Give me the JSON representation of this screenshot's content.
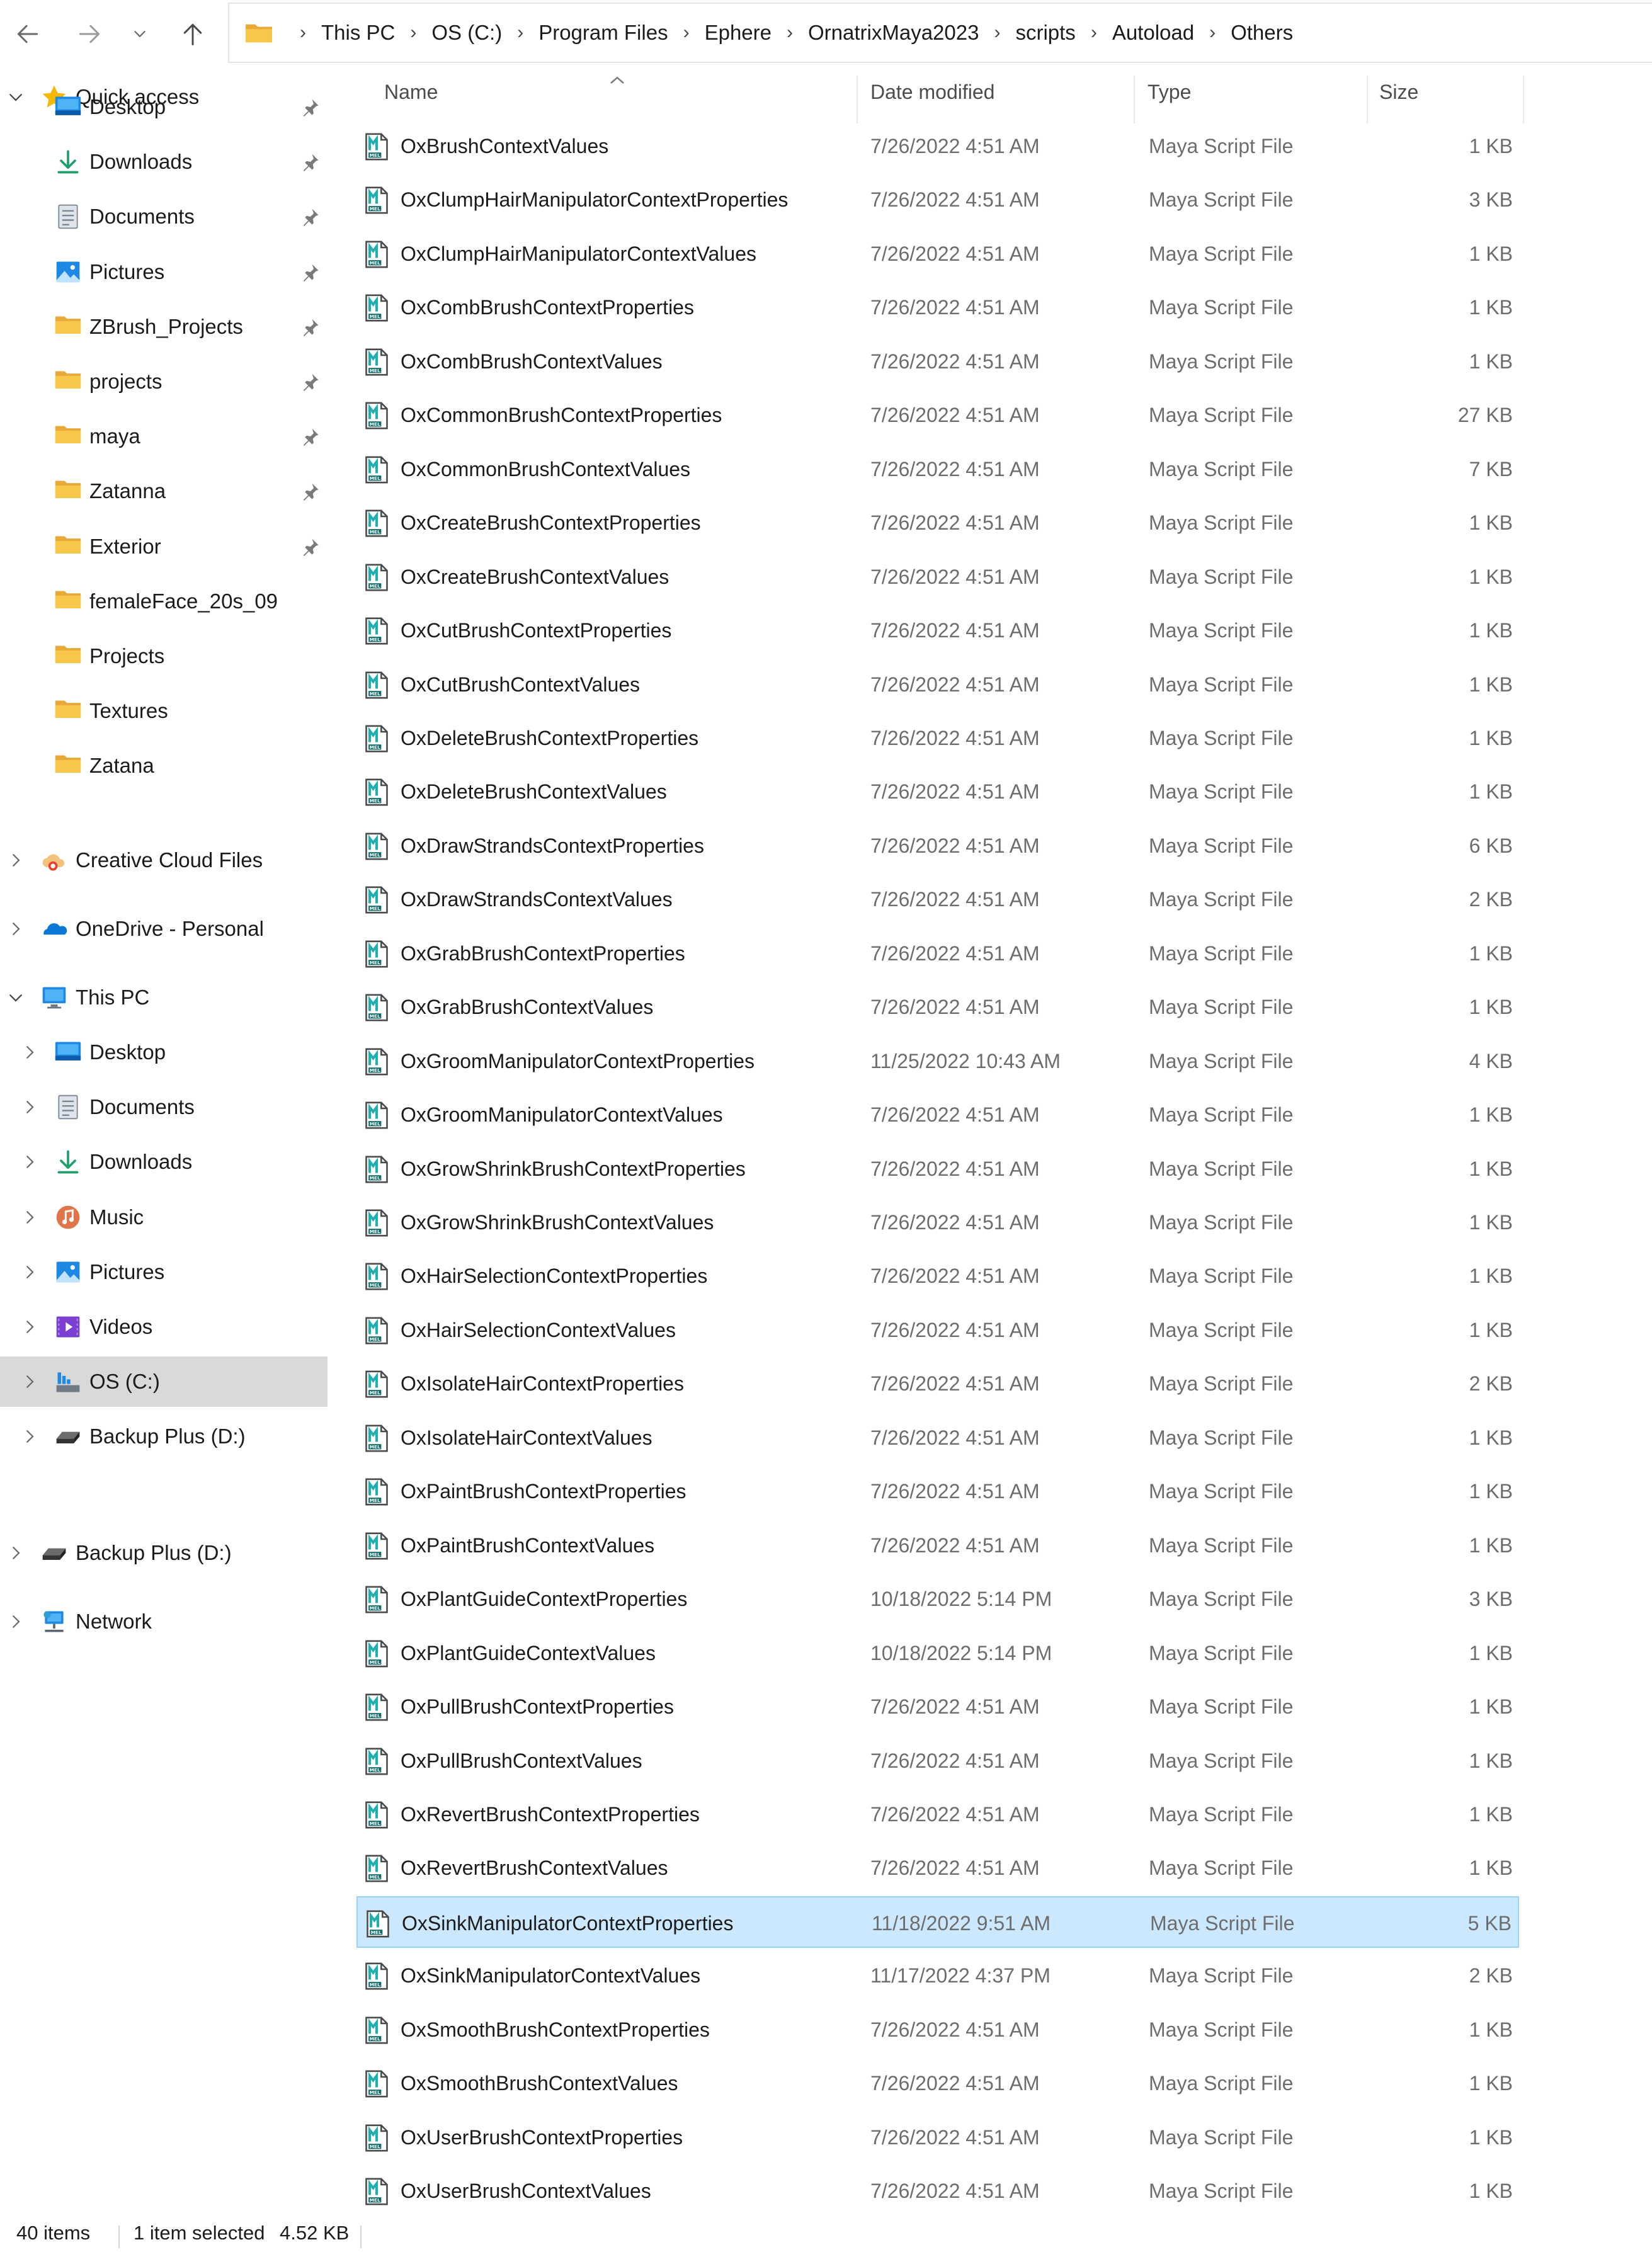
{
  "address": {
    "crumbs": [
      "This PC",
      "OS (C:)",
      "Program Files",
      "Ephere",
      "OrnatrixMaya2023",
      "scripts",
      "Autoload",
      "Others"
    ],
    "icon": "folder-icon"
  },
  "sidebar": {
    "quick_access": {
      "label": "Quick access",
      "icon": "star-icon",
      "items": [
        {
          "label": "Desktop",
          "icon": "desktop-icon",
          "pinned": true
        },
        {
          "label": "Downloads",
          "icon": "download-icon",
          "pinned": true
        },
        {
          "label": "Documents",
          "icon": "documents-icon",
          "pinned": true
        },
        {
          "label": "Pictures",
          "icon": "pictures-icon",
          "pinned": true
        },
        {
          "label": "ZBrush_Projects",
          "icon": "folder-icon",
          "pinned": true
        },
        {
          "label": "projects",
          "icon": "folder-icon",
          "pinned": true
        },
        {
          "label": "maya",
          "icon": "folder-icon",
          "pinned": true
        },
        {
          "label": "Zatanna",
          "icon": "folder-icon",
          "pinned": true
        },
        {
          "label": "Exterior",
          "icon": "folder-icon",
          "pinned": true
        },
        {
          "label": "femaleFace_20s_09",
          "icon": "folder-icon",
          "pinned": false
        },
        {
          "label": "Projects",
          "icon": "folder-icon",
          "pinned": false
        },
        {
          "label": "Textures",
          "icon": "folder-icon",
          "pinned": false
        },
        {
          "label": "Zatana",
          "icon": "folder-icon",
          "pinned": false
        }
      ]
    },
    "creative_cloud": {
      "label": "Creative Cloud Files",
      "icon": "creative-cloud-icon"
    },
    "onedrive": {
      "label": "OneDrive - Personal",
      "icon": "onedrive-cloud-icon"
    },
    "this_pc": {
      "label": "This PC",
      "icon": "computer-icon",
      "items": [
        {
          "label": "Desktop",
          "icon": "desktop-icon"
        },
        {
          "label": "Documents",
          "icon": "documents-icon"
        },
        {
          "label": "Downloads",
          "icon": "download-icon"
        },
        {
          "label": "Music",
          "icon": "music-icon"
        },
        {
          "label": "Pictures",
          "icon": "pictures-icon"
        },
        {
          "label": "Videos",
          "icon": "videos-icon"
        },
        {
          "label": "OS (C:)",
          "icon": "drive-icon",
          "selected": true
        },
        {
          "label": "Backup Plus (D:)",
          "icon": "external-drive-icon"
        }
      ]
    },
    "backup_plus": {
      "label": "Backup Plus (D:)",
      "icon": "external-drive-icon"
    },
    "network": {
      "label": "Network",
      "icon": "network-icon"
    }
  },
  "columns": {
    "name": "Name",
    "date": "Date modified",
    "type": "Type",
    "size": "Size"
  },
  "files": [
    {
      "name": "OxBrushContextValues",
      "date": "7/26/2022 4:51 AM",
      "type": "Maya Script File",
      "size": "1 KB"
    },
    {
      "name": "OxClumpHairManipulatorContextProperties",
      "date": "7/26/2022 4:51 AM",
      "type": "Maya Script File",
      "size": "3 KB"
    },
    {
      "name": "OxClumpHairManipulatorContextValues",
      "date": "7/26/2022 4:51 AM",
      "type": "Maya Script File",
      "size": "1 KB"
    },
    {
      "name": "OxCombBrushContextProperties",
      "date": "7/26/2022 4:51 AM",
      "type": "Maya Script File",
      "size": "1 KB"
    },
    {
      "name": "OxCombBrushContextValues",
      "date": "7/26/2022 4:51 AM",
      "type": "Maya Script File",
      "size": "1 KB"
    },
    {
      "name": "OxCommonBrushContextProperties",
      "date": "7/26/2022 4:51 AM",
      "type": "Maya Script File",
      "size": "27 KB"
    },
    {
      "name": "OxCommonBrushContextValues",
      "date": "7/26/2022 4:51 AM",
      "type": "Maya Script File",
      "size": "7 KB"
    },
    {
      "name": "OxCreateBrushContextProperties",
      "date": "7/26/2022 4:51 AM",
      "type": "Maya Script File",
      "size": "1 KB"
    },
    {
      "name": "OxCreateBrushContextValues",
      "date": "7/26/2022 4:51 AM",
      "type": "Maya Script File",
      "size": "1 KB"
    },
    {
      "name": "OxCutBrushContextProperties",
      "date": "7/26/2022 4:51 AM",
      "type": "Maya Script File",
      "size": "1 KB"
    },
    {
      "name": "OxCutBrushContextValues",
      "date": "7/26/2022 4:51 AM",
      "type": "Maya Script File",
      "size": "1 KB"
    },
    {
      "name": "OxDeleteBrushContextProperties",
      "date": "7/26/2022 4:51 AM",
      "type": "Maya Script File",
      "size": "1 KB"
    },
    {
      "name": "OxDeleteBrushContextValues",
      "date": "7/26/2022 4:51 AM",
      "type": "Maya Script File",
      "size": "1 KB"
    },
    {
      "name": "OxDrawStrandsContextProperties",
      "date": "7/26/2022 4:51 AM",
      "type": "Maya Script File",
      "size": "6 KB"
    },
    {
      "name": "OxDrawStrandsContextValues",
      "date": "7/26/2022 4:51 AM",
      "type": "Maya Script File",
      "size": "2 KB"
    },
    {
      "name": "OxGrabBrushContextProperties",
      "date": "7/26/2022 4:51 AM",
      "type": "Maya Script File",
      "size": "1 KB"
    },
    {
      "name": "OxGrabBrushContextValues",
      "date": "7/26/2022 4:51 AM",
      "type": "Maya Script File",
      "size": "1 KB"
    },
    {
      "name": "OxGroomManipulatorContextProperties",
      "date": "11/25/2022 10:43 AM",
      "type": "Maya Script File",
      "size": "4 KB"
    },
    {
      "name": "OxGroomManipulatorContextValues",
      "date": "7/26/2022 4:51 AM",
      "type": "Maya Script File",
      "size": "1 KB"
    },
    {
      "name": "OxGrowShrinkBrushContextProperties",
      "date": "7/26/2022 4:51 AM",
      "type": "Maya Script File",
      "size": "1 KB"
    },
    {
      "name": "OxGrowShrinkBrushContextValues",
      "date": "7/26/2022 4:51 AM",
      "type": "Maya Script File",
      "size": "1 KB"
    },
    {
      "name": "OxHairSelectionContextProperties",
      "date": "7/26/2022 4:51 AM",
      "type": "Maya Script File",
      "size": "1 KB"
    },
    {
      "name": "OxHairSelectionContextValues",
      "date": "7/26/2022 4:51 AM",
      "type": "Maya Script File",
      "size": "1 KB"
    },
    {
      "name": "OxIsolateHairContextProperties",
      "date": "7/26/2022 4:51 AM",
      "type": "Maya Script File",
      "size": "2 KB"
    },
    {
      "name": "OxIsolateHairContextValues",
      "date": "7/26/2022 4:51 AM",
      "type": "Maya Script File",
      "size": "1 KB"
    },
    {
      "name": "OxPaintBrushContextProperties",
      "date": "7/26/2022 4:51 AM",
      "type": "Maya Script File",
      "size": "1 KB"
    },
    {
      "name": "OxPaintBrushContextValues",
      "date": "7/26/2022 4:51 AM",
      "type": "Maya Script File",
      "size": "1 KB"
    },
    {
      "name": "OxPlantGuideContextProperties",
      "date": "10/18/2022 5:14 PM",
      "type": "Maya Script File",
      "size": "3 KB"
    },
    {
      "name": "OxPlantGuideContextValues",
      "date": "10/18/2022 5:14 PM",
      "type": "Maya Script File",
      "size": "1 KB"
    },
    {
      "name": "OxPullBrushContextProperties",
      "date": "7/26/2022 4:51 AM",
      "type": "Maya Script File",
      "size": "1 KB"
    },
    {
      "name": "OxPullBrushContextValues",
      "date": "7/26/2022 4:51 AM",
      "type": "Maya Script File",
      "size": "1 KB"
    },
    {
      "name": "OxRevertBrushContextProperties",
      "date": "7/26/2022 4:51 AM",
      "type": "Maya Script File",
      "size": "1 KB"
    },
    {
      "name": "OxRevertBrushContextValues",
      "date": "7/26/2022 4:51 AM",
      "type": "Maya Script File",
      "size": "1 KB"
    },
    {
      "name": "OxSinkManipulatorContextProperties",
      "date": "11/18/2022 9:51 AM",
      "type": "Maya Script File",
      "size": "5 KB",
      "selected": true
    },
    {
      "name": "OxSinkManipulatorContextValues",
      "date": "11/17/2022 4:37 PM",
      "type": "Maya Script File",
      "size": "2 KB"
    },
    {
      "name": "OxSmoothBrushContextProperties",
      "date": "7/26/2022 4:51 AM",
      "type": "Maya Script File",
      "size": "1 KB"
    },
    {
      "name": "OxSmoothBrushContextValues",
      "date": "7/26/2022 4:51 AM",
      "type": "Maya Script File",
      "size": "1 KB"
    },
    {
      "name": "OxUserBrushContextProperties",
      "date": "7/26/2022 4:51 AM",
      "type": "Maya Script File",
      "size": "1 KB"
    },
    {
      "name": "OxUserBrushContextValues",
      "date": "7/26/2022 4:51 AM",
      "type": "Maya Script File",
      "size": "1 KB"
    }
  ],
  "file_icon": "maya-mel-file-icon",
  "status": {
    "items": "40 items",
    "selected": "1 item selected",
    "size": "4.52 KB"
  },
  "colors": {
    "selection_bg": "#cce8ff",
    "selection_border": "#99d1ff",
    "sidebar_selected": "#d9d9d9",
    "folder": "#f8c74a"
  }
}
